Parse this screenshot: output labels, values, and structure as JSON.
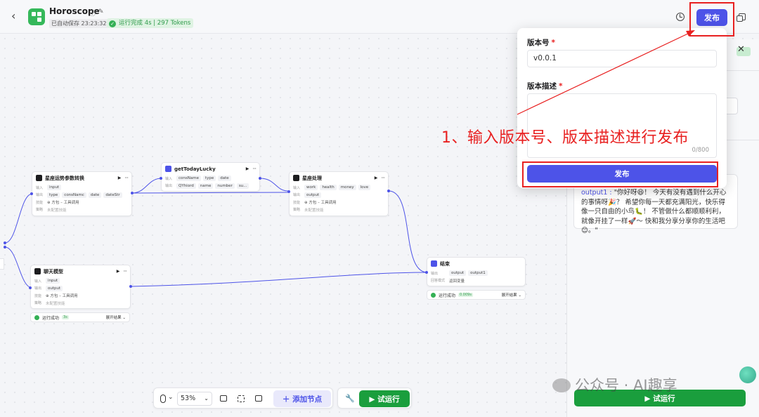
{
  "header": {
    "back": "‹",
    "app_title": "Horoscope",
    "info_icon": "ⓘ",
    "edit_icon": "✎",
    "autosave": "已自动保存 23:23:32",
    "run_status": "运行完成 4s | 297 Tokens",
    "publish": "发布"
  },
  "nodes": {
    "star_convert": {
      "title": "星座运势参数转换",
      "in_label": "输入",
      "in": [
        "input"
      ],
      "out_label": "输出",
      "out": [
        "type",
        "consNamc",
        "date",
        "dateStr"
      ],
      "skill_label": "技能",
      "skill": "⊕ 方包 – 工具调用",
      "strategy_label": "策略",
      "strategy": "未配置技能"
    },
    "get_today": {
      "title": "getTodayLucky",
      "in_label": "输入",
      "in": [
        "consName",
        "type",
        "date"
      ],
      "out_label": "输出",
      "out": [
        "QYhiord",
        "name",
        "number",
        "su..."
      ]
    },
    "star_process": {
      "title": "星座处理",
      "in_label": "输入",
      "in": [
        "work",
        "health",
        "money",
        "love"
      ],
      "out_label": "输出",
      "out": [
        "output"
      ],
      "skill_label": "技能",
      "skill": "⊕ 方包 – 工具调用",
      "strategy_label": "策略",
      "strategy": "未配置技能"
    },
    "chat_model": {
      "title": "聊天模型",
      "in_label": "输入",
      "in": [
        "input"
      ],
      "out_label": "输出",
      "out": [
        "output"
      ],
      "skill_label": "技能",
      "skill": "⊕ 方包 – 工具调用",
      "strategy_label": "策略",
      "strategy": "未配置技能",
      "status": "运行成功",
      "time": "3s",
      "expand": "展开结果 ⌄"
    },
    "end": {
      "title": "结束",
      "out_label": "输出",
      "out": [
        "output",
        "output1"
      ],
      "mode_label": "回答模式",
      "mode": "返回变量",
      "status": "运行成功",
      "time": "0.009s",
      "expand": "展开结果 ⌄"
    }
  },
  "popover": {
    "version_label": "版本号",
    "version_value": "v0.0.1",
    "desc_label": "版本描述",
    "counter": "0/800",
    "publish": "发布",
    "required": "*"
  },
  "annotation": "1、输入版本号、版本描述进行发布",
  "side_panel": {
    "output_key": "output1 :",
    "output_text": " \"你好呀😆！ 今天有没有遇到什么开心的事情呀🎉？ 希望你每一天都充满阳光，快乐得像一只自由的小鸟🐛！ 不管做什么都顺顺利利，就像开挂了一样🚀～ 快和我分享分享你的生活吧😊。\"",
    "close": "✕",
    "run": "▶  试运行"
  },
  "toolbar": {
    "zoom": "53%",
    "add_node": "＋  添加节点",
    "run": "▶  试运行"
  },
  "watermark": "公众号 · AI趣享",
  "colors": {
    "primary": "#4d53e8",
    "success": "#1a9e3d",
    "annotation": "#e82020"
  }
}
